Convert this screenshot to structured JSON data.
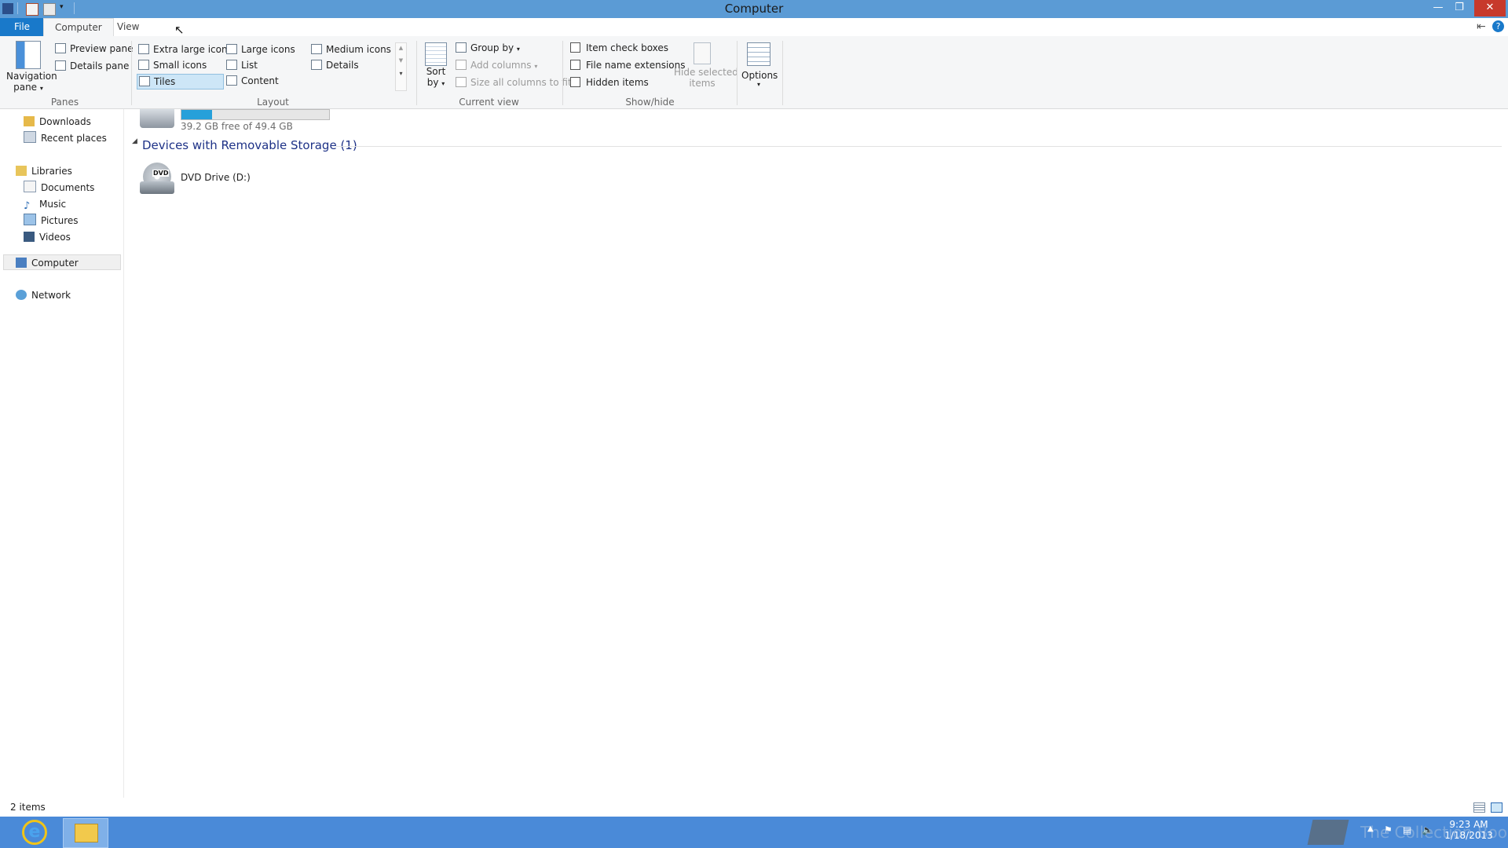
{
  "window": {
    "title": "Computer"
  },
  "tabs": {
    "file": "File",
    "computer": "Computer",
    "view": "View"
  },
  "ribbon": {
    "panes": {
      "navigation_pane_line1": "Navigation",
      "navigation_pane_line2": "pane",
      "preview_pane": "Preview pane",
      "details_pane": "Details pane",
      "group_label": "Panes"
    },
    "layout": {
      "extra_large_icons": "Extra large icons",
      "large_icons": "Large icons",
      "medium_icons": "Medium icons",
      "small_icons": "Small icons",
      "list": "List",
      "details": "Details",
      "tiles": "Tiles",
      "content": "Content",
      "group_label": "Layout"
    },
    "current_view": {
      "sort_by_line1": "Sort",
      "sort_by_line2": "by",
      "group_by": "Group by",
      "add_columns": "Add columns",
      "size_all_columns": "Size all columns to fit",
      "group_label": "Current view"
    },
    "show_hide": {
      "item_check_boxes": "Item check boxes",
      "file_name_extensions": "File name extensions",
      "hidden_items": "Hidden items",
      "hide_selected_line1": "Hide selected",
      "hide_selected_line2": "items",
      "group_label": "Show/hide"
    },
    "options": {
      "label": "Options"
    }
  },
  "nav": {
    "downloads": "Downloads",
    "recent_places": "Recent places",
    "libraries": "Libraries",
    "documents": "Documents",
    "music": "Music",
    "pictures": "Pictures",
    "videos": "Videos",
    "computer": "Computer",
    "network": "Network"
  },
  "content": {
    "drive_c_free": "39.2 GB free of 49.4 GB",
    "drive_c_used_fraction": 0.21,
    "removable_group": "Devices with Removable Storage (1)",
    "dvd_drive": "DVD Drive (D:)",
    "dvd_badge": "DVD"
  },
  "status": {
    "items": "2 items"
  },
  "taskbar": {
    "time": "9:23 AM",
    "date": "1/18/2013",
    "watermark": "The Collection Book"
  },
  "colors": {
    "titlebar": "#5b9bd5",
    "file_tab": "#1979ca",
    "taskbar": "#4a8ad8",
    "group_heading": "#1e3287",
    "drive_bar": "#26a0da"
  }
}
